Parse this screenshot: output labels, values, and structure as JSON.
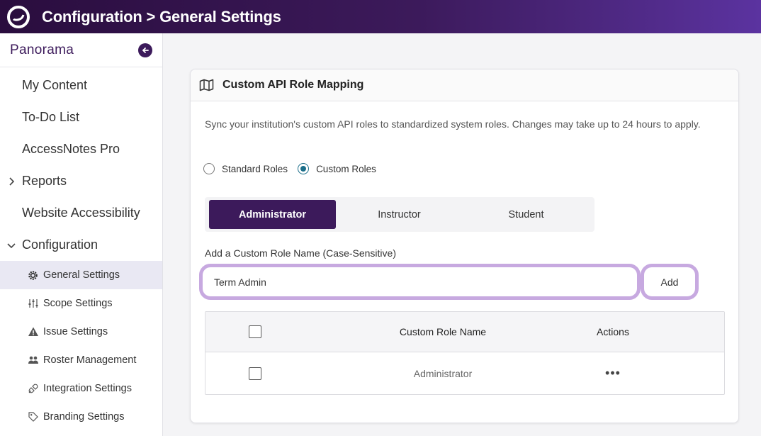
{
  "header": {
    "title": "Configuration > General Settings",
    "logo_icon": "logo-icon"
  },
  "sidebar": {
    "brand": "Panorama",
    "collapse_icon": "arrow-left-circle-icon",
    "items": [
      {
        "label": "My Content"
      },
      {
        "label": "To-Do List"
      },
      {
        "label": "AccessNotes Pro"
      },
      {
        "label": "Reports",
        "expandable": true,
        "expanded": false
      },
      {
        "label": "Website Accessibility"
      },
      {
        "label": "Configuration",
        "expandable": true,
        "expanded": true
      }
    ],
    "sub_items": [
      {
        "label": "General Settings",
        "icon": "gear-icon",
        "active": true
      },
      {
        "label": "Scope Settings",
        "icon": "sliders-icon"
      },
      {
        "label": "Issue Settings",
        "icon": "warning-icon"
      },
      {
        "label": "Roster Management",
        "icon": "users-icon"
      },
      {
        "label": "Integration Settings",
        "icon": "plug-icon"
      },
      {
        "label": "Branding Settings",
        "icon": "tag-icon"
      }
    ]
  },
  "card": {
    "title": "Custom API Role Mapping",
    "title_icon": "map-icon",
    "description": "Sync your institution's custom API roles to standardized system roles. Changes may take up to 24 hours to apply.",
    "radios": [
      {
        "label": "Standard Roles",
        "checked": false
      },
      {
        "label": "Custom Roles",
        "checked": true
      }
    ],
    "tabs": [
      {
        "label": "Administrator",
        "active": true
      },
      {
        "label": "Instructor"
      },
      {
        "label": "Student"
      }
    ],
    "field_label": "Add a Custom Role Name (Case-Sensitive)",
    "input_value": "Term Admin",
    "add_label": "Add",
    "table": {
      "columns": [
        "Custom Role Name",
        "Actions"
      ],
      "rows": [
        {
          "name": "Administrator",
          "actions": "•••"
        }
      ]
    }
  },
  "colors": {
    "brand_dark": "#3c1a5b",
    "focus_ring": "#c7a9e0",
    "radio_checked": "#1c6f8a"
  }
}
